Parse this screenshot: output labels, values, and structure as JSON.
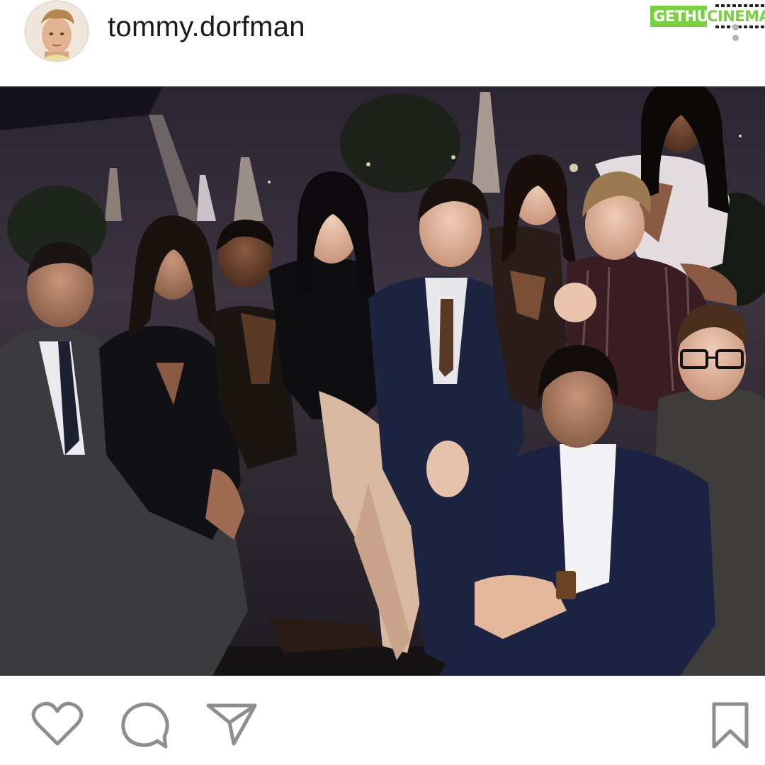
{
  "post": {
    "username": "tommy.dorfman"
  },
  "watermark": {
    "part1": "GETHU",
    "part2": "CINEMA"
  },
  "colors": {
    "watermark_green": "#7ad13f",
    "icon_stroke": "#8e8e8e",
    "text": "#1a1a1a"
  },
  "icons": [
    "heart-icon",
    "comment-icon",
    "share-icon",
    "bookmark-icon",
    "more-options-icon"
  ]
}
